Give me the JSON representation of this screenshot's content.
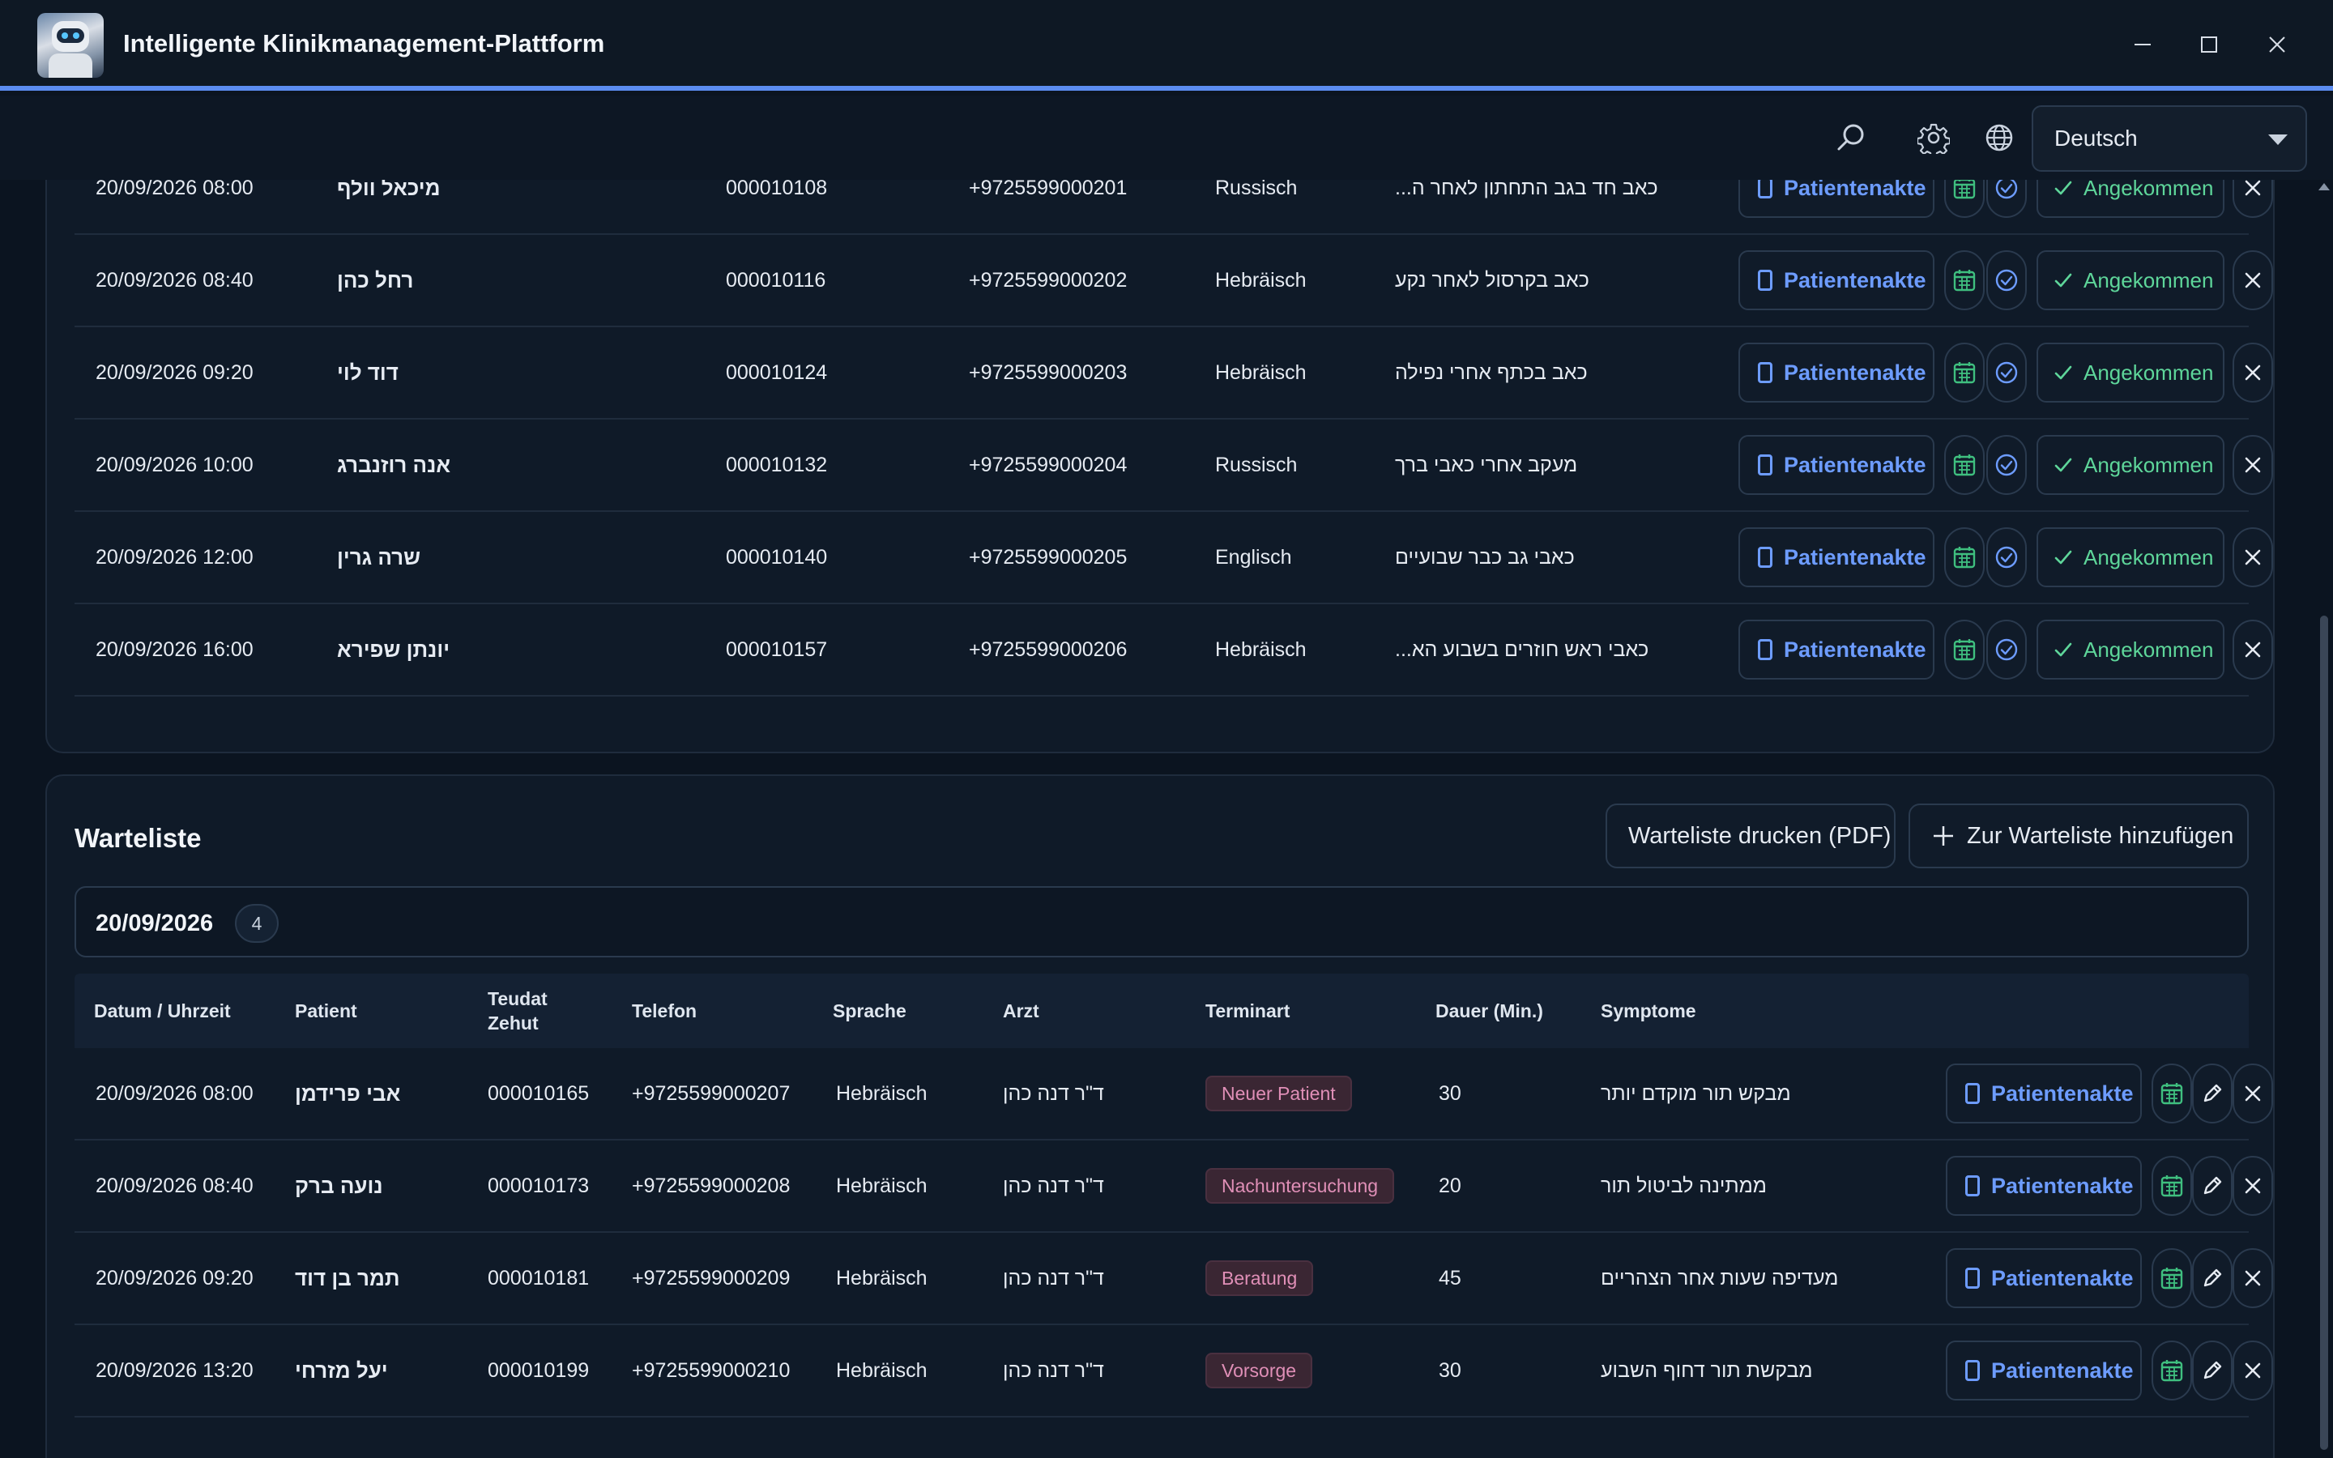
{
  "app": {
    "title": "Intelligente Klinikmanagement-Plattform"
  },
  "toolbar": {
    "language": "Deutsch"
  },
  "appointments": {
    "record_label": "Patientenakte",
    "arrived_label": "Angekommen",
    "rows": [
      {
        "datetime": "20/09/2026 08:00",
        "patient": "מיכאל וולף",
        "id": "000010108",
        "phone": "+9725599000201",
        "language": "Russisch",
        "symptoms": "כאב חד בגב התחתון לאחר ה..."
      },
      {
        "datetime": "20/09/2026 08:40",
        "patient": "רחל כהן",
        "id": "000010116",
        "phone": "+9725599000202",
        "language": "Hebräisch",
        "symptoms": "כאב בקרסול לאחר נקע"
      },
      {
        "datetime": "20/09/2026 09:20",
        "patient": "דוד לוי",
        "id": "000010124",
        "phone": "+9725599000203",
        "language": "Hebräisch",
        "symptoms": "כאב בכתף אחרי נפילה"
      },
      {
        "datetime": "20/09/2026 10:00",
        "patient": "אנה רוזנברג",
        "id": "000010132",
        "phone": "+9725599000204",
        "language": "Russisch",
        "symptoms": "מעקב אחרי כאבי ברך"
      },
      {
        "datetime": "20/09/2026 12:00",
        "patient": "שרה גרין",
        "id": "000010140",
        "phone": "+9725599000205",
        "language": "Englisch",
        "symptoms": "כאבי גב כבר שבועיים"
      },
      {
        "datetime": "20/09/2026 16:00",
        "patient": "יונתן שפירא",
        "id": "000010157",
        "phone": "+9725599000206",
        "language": "Hebräisch",
        "symptoms": "כאבי ראש חוזרים בשבוע הא..."
      }
    ]
  },
  "waitlist": {
    "title": "Warteliste",
    "print_label": "Warteliste drucken (PDF)",
    "add_label": "Zur Warteliste hinzufügen",
    "record_label": "Patientenakte",
    "group": {
      "date": "20/09/2026",
      "count": "4"
    },
    "columns": {
      "datetime": "Datum / Uhrzeit",
      "patient": "Patient",
      "id_line1": "Teudat",
      "id_line2": "Zehut",
      "phone": "Telefon",
      "language": "Sprache",
      "doctor": "Arzt",
      "type": "Terminart",
      "duration": "Dauer (Min.)",
      "symptoms": "Symptome"
    },
    "rows": [
      {
        "datetime": "20/09/2026 08:00",
        "patient": "אבי פרידמן",
        "id": "000010165",
        "phone": "+9725599000207",
        "language": "Hebräisch",
        "doctor": "ד\"ר דנה כהן",
        "type": "Neuer Patient",
        "duration": "30",
        "symptoms": "מבקש תור מוקדם יותר"
      },
      {
        "datetime": "20/09/2026 08:40",
        "patient": "נועה ברק",
        "id": "000010173",
        "phone": "+9725599000208",
        "language": "Hebräisch",
        "doctor": "ד\"ר דנה כהן",
        "type": "Nachuntersuchung",
        "duration": "20",
        "symptoms": "ממתינה לביטול תור"
      },
      {
        "datetime": "20/09/2026 09:20",
        "patient": "תמר בן דוד",
        "id": "000010181",
        "phone": "+9725599000209",
        "language": "Hebräisch",
        "doctor": "ד\"ר דנה כהן",
        "type": "Beratung",
        "duration": "45",
        "symptoms": "מעדיפה שעות אחר הצהריים"
      },
      {
        "datetime": "20/09/2026 13:20",
        "patient": "יעל מזרחי",
        "id": "000010199",
        "phone": "+9725599000210",
        "language": "Hebräisch",
        "doctor": "ד\"ר דנה כהן",
        "type": "Vorsorge",
        "duration": "30",
        "symptoms": "מבקשת תור דחוף השבוע"
      }
    ]
  }
}
